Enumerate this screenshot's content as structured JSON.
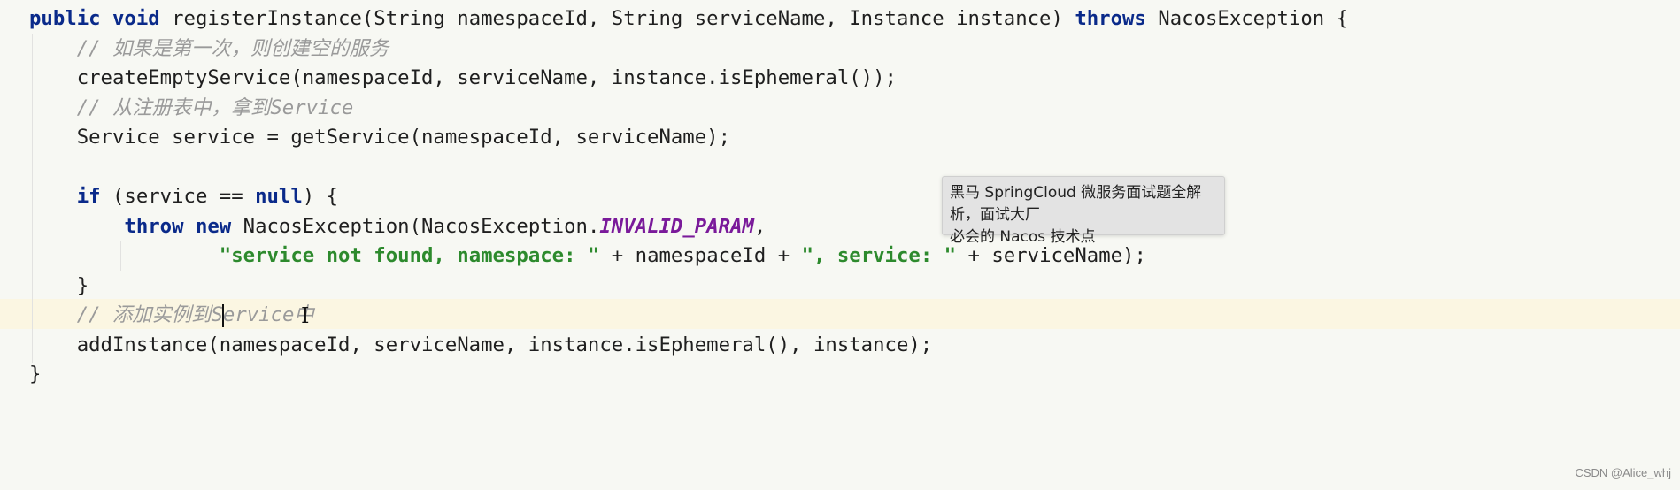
{
  "code": {
    "lines": [
      [
        [
          "kw",
          "public void "
        ],
        [
          "",
          "registerInstance(String namespaceId, String serviceName, Instance instance) "
        ],
        [
          "kw",
          "throws "
        ],
        [
          "",
          "NacosException {"
        ]
      ],
      [
        [
          "",
          "    "
        ],
        [
          "cm",
          "// 如果是第一次，则创建空的服务"
        ]
      ],
      [
        [
          "",
          "    createEmptyService(namespaceId, serviceName, instance.isEphemeral());"
        ]
      ],
      [
        [
          "",
          "    "
        ],
        [
          "cm",
          "// 从注册表中，拿到Service"
        ]
      ],
      [
        [
          "",
          "    Service service = getService(namespaceId, serviceName);"
        ]
      ],
      [],
      [
        [
          "",
          "    "
        ],
        [
          "kw",
          "if "
        ],
        [
          "",
          "(service == "
        ],
        [
          "kw",
          "null"
        ],
        [
          "",
          ") {"
        ]
      ],
      [
        [
          "",
          "        "
        ],
        [
          "kw",
          "throw new "
        ],
        [
          "",
          "NacosException(NacosException."
        ],
        [
          "cn",
          "INVALID_PARAM"
        ],
        [
          "",
          ","
        ]
      ],
      [
        [
          "",
          "                "
        ],
        [
          "st",
          "\"service not found, namespace: \""
        ],
        [
          "",
          " + namespaceId + "
        ],
        [
          "st",
          "\", service: \""
        ],
        [
          "",
          " + serviceName);"
        ]
      ],
      [
        [
          "",
          "    }"
        ]
      ],
      [
        [
          "",
          "    "
        ],
        [
          "cm",
          "// 添加实例到S"
        ],
        [
          "caret",
          ""
        ],
        [
          "cm",
          "ervice中"
        ]
      ],
      [
        [
          "",
          "    addInstance(namespaceId, serviceName, instance.isEphemeral(), instance);"
        ]
      ],
      [
        [
          "",
          "}"
        ]
      ]
    ],
    "highlighted_line": 11,
    "colors": {
      "keyword": "#0a2a8a",
      "comment": "#9a9a9a",
      "string": "#2d8a2d",
      "constant": "#7a1a9a",
      "background": "#f7f8f3",
      "line_highlight": "#fbf6e2"
    }
  },
  "tooltip": {
    "line1": "黑马 SpringCloud 微服务面试题全解析，面试大厂",
    "line2": "必会的 Nacos 技术点"
  },
  "watermark": "CSDN @Alice_whj"
}
